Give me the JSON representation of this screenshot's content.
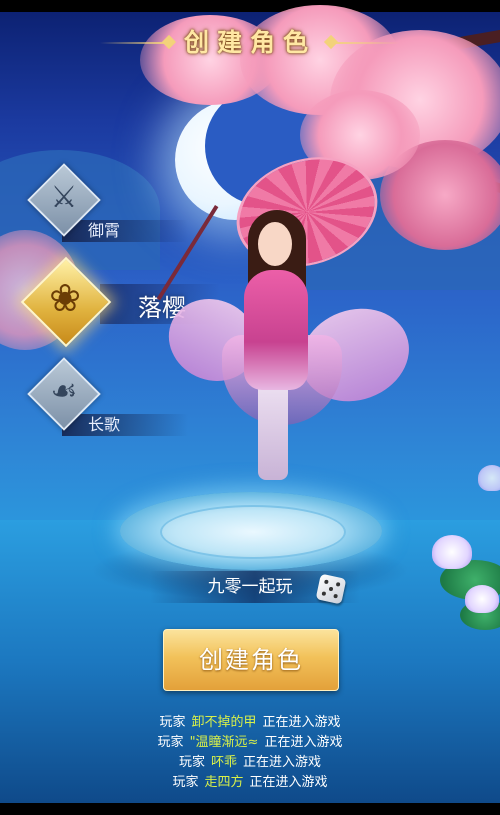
{
  "title": "创建角色",
  "classes": [
    {
      "label": "御霄",
      "icon": "sword-crest-icon",
      "selected": false
    },
    {
      "label": "落樱",
      "icon": "lotus-crest-icon",
      "selected": true
    },
    {
      "label": "长歌",
      "icon": "bird-crest-icon",
      "selected": false
    }
  ],
  "character_name": "九零一起玩",
  "create_button": "创建角色",
  "ticker": [
    {
      "prefix": "玩家",
      "name": "卸不掉的甲",
      "suffix": "正在进入游戏"
    },
    {
      "prefix": "玩家",
      "name": "\"温瞳渐远≈",
      "suffix": "正在进入游戏"
    },
    {
      "prefix": "玩家",
      "name": "吥乖",
      "suffix": "正在进入游戏"
    },
    {
      "prefix": "玩家",
      "name": "走四方",
      "suffix": "正在进入游戏"
    }
  ],
  "colors": {
    "accent_gold": "#f2c25a",
    "ticker_name": "#d8f04a",
    "title_text": "#ffe7a3"
  }
}
